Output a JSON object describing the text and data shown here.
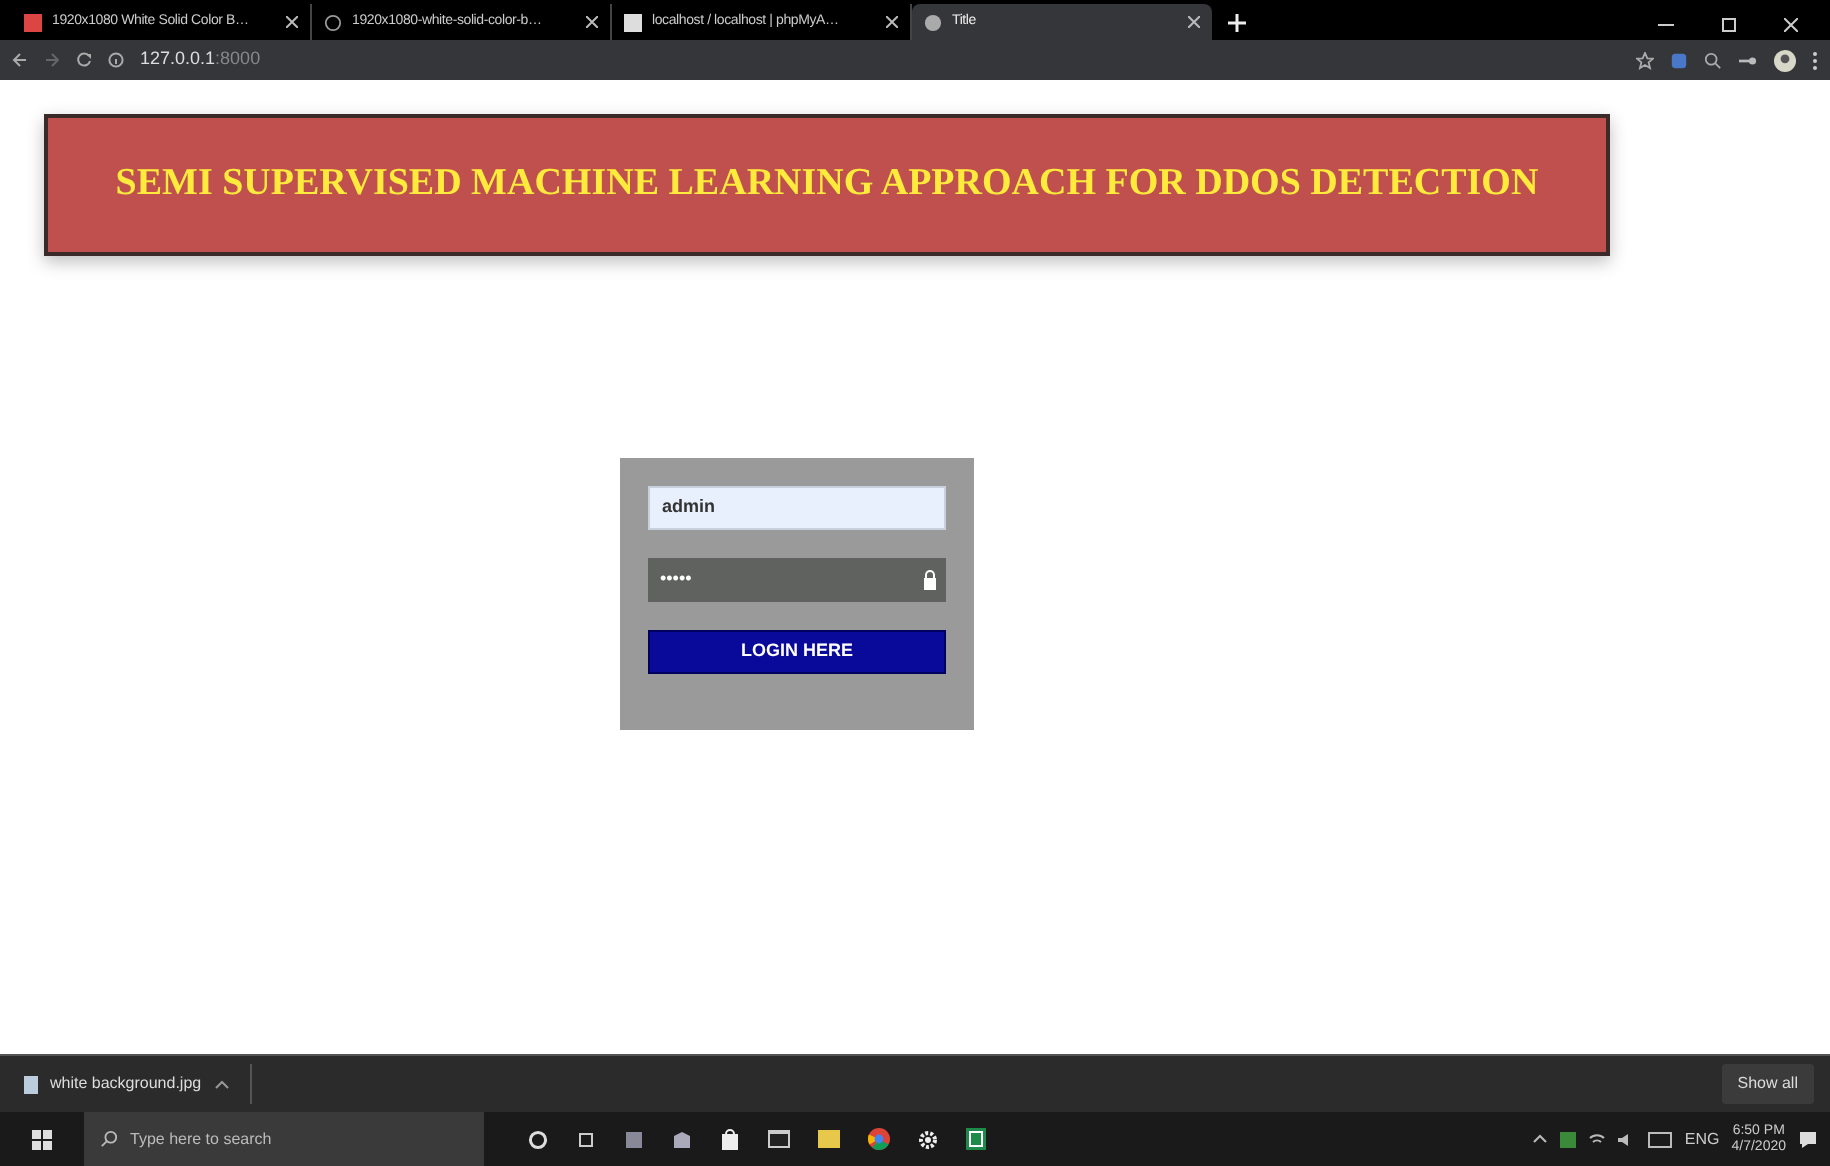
{
  "browser": {
    "tabs": [
      {
        "title": "1920x1080 White Solid Color B…",
        "selected": false
      },
      {
        "title": "1920x1080-white-solid-color-b…",
        "selected": false
      },
      {
        "title": "localhost / localhost | phpMyA…",
        "selected": false
      },
      {
        "title": "Title",
        "selected": true
      }
    ],
    "address": {
      "host": "127.0.0.1",
      "port": ":8000"
    }
  },
  "page": {
    "banner": "SEMI SUPERVISED MACHINE LEARNING APPROACH FOR DDOS DETECTION",
    "login": {
      "username": "admin",
      "password": "•••••",
      "button": "LOGIN HERE"
    }
  },
  "downloads": {
    "file": "white background.jpg",
    "show_all": "Show all"
  },
  "taskbar": {
    "search_placeholder": "Type here to search",
    "language": "ENG",
    "time": "6:50 PM",
    "date": "4/7/2020"
  }
}
